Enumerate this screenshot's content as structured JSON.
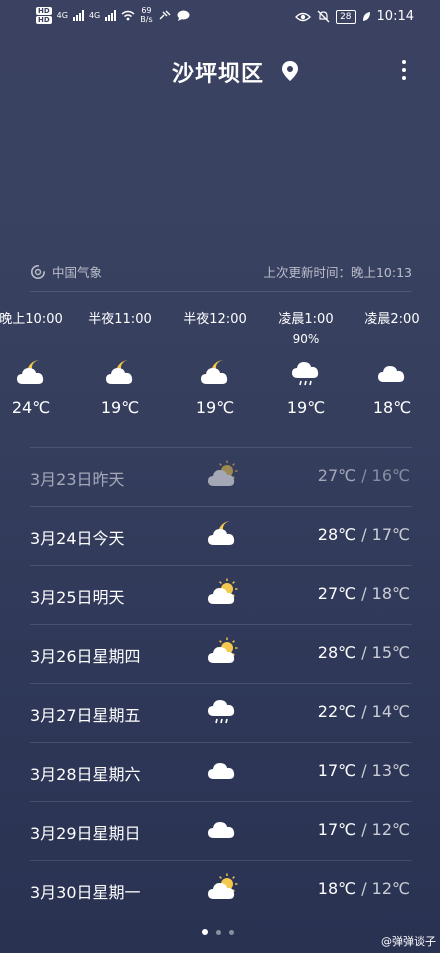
{
  "status_bar": {
    "hd1": "HD",
    "hd2": "HD",
    "sig1": "4G",
    "sig2": "4G",
    "net_speed_value": "69",
    "net_speed_unit": "B/s",
    "battery": "28",
    "time": "10:14"
  },
  "header": {
    "city": "沙坪坝区"
  },
  "source": {
    "provider": "中国气象",
    "updated": "上次更新时间：晚上10:13"
  },
  "hourly": [
    {
      "time": "晚上10:00",
      "prob": "",
      "icon": "moon-cloud-icon",
      "temp": "24℃"
    },
    {
      "time": "半夜11:00",
      "prob": "",
      "icon": "moon-cloud-icon",
      "temp": "19℃"
    },
    {
      "time": "半夜12:00",
      "prob": "",
      "icon": "moon-cloud-icon",
      "temp": "19℃"
    },
    {
      "time": "凌晨1:00",
      "prob": "90%",
      "icon": "rain-cloud-icon",
      "temp": "19℃"
    },
    {
      "time": "凌晨2:00",
      "prob": "",
      "icon": "cloud-icon",
      "temp": "18℃"
    }
  ],
  "daily": [
    {
      "name": "3月23日昨天",
      "icon": "sun-cloud-icon",
      "high": "27℃",
      "low": "16℃"
    },
    {
      "name": "3月24日今天",
      "icon": "moon-cloud-icon",
      "high": "28℃",
      "low": "17℃"
    },
    {
      "name": "3月25日明天",
      "icon": "sun-cloud-icon",
      "high": "27℃",
      "low": "18℃"
    },
    {
      "name": "3月26日星期四",
      "icon": "sun-cloud-icon",
      "high": "28℃",
      "low": "15℃"
    },
    {
      "name": "3月27日星期五",
      "icon": "rain-cloud-icon",
      "high": "22℃",
      "low": "14℃"
    },
    {
      "name": "3月28日星期六",
      "icon": "cloud-icon",
      "high": "17℃",
      "low": "13℃"
    },
    {
      "name": "3月29日星期日",
      "icon": "cloud-icon",
      "high": "17℃",
      "low": "12℃"
    },
    {
      "name": "3月30日星期一",
      "icon": "sun-cloud-icon",
      "high": "18℃",
      "low": "12℃"
    }
  ],
  "temp_separator": " / ",
  "watermark": "@弹弹谈子",
  "colors": {
    "background_top": "#3b4160",
    "background_bottom": "#2a3252",
    "sun": "#f2c94c",
    "cloud": "#ffffff"
  }
}
